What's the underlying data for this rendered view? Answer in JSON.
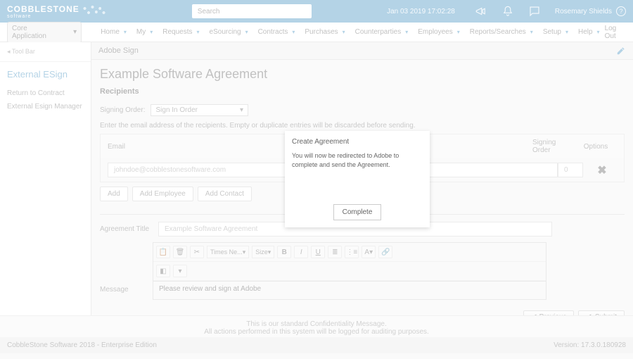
{
  "brand": {
    "name": "COBBLESTONE",
    "sub": "software"
  },
  "search": {
    "placeholder": "Search"
  },
  "timestamp": "Jan 03 2019 17:02:28",
  "user": {
    "name": "Rosemary Shields"
  },
  "app_selector": "Core Application",
  "menu": [
    "Home",
    "My",
    "Requests",
    "eSourcing",
    "Contracts",
    "Purchases",
    "Counterparties",
    "Employees",
    "Reports/Searches",
    "Setup",
    "Help"
  ],
  "logout": "Log Out",
  "sidebar": {
    "toolbar": "◂ Tool Bar",
    "title": "External ESign",
    "links": [
      "Return to Contract",
      "External Esign Manager"
    ]
  },
  "pane": {
    "header": "Adobe Sign"
  },
  "page": {
    "title": "Example Software Agreement",
    "section": "Recipients",
    "signing_label": "Signing Order:",
    "signing_value": "Sign In Order",
    "hint": "Enter the email address of the recipients. Empty or duplicate entries will be discarded before sending.",
    "col_email": "Email",
    "col_order": "Signing Order",
    "col_options": "Options",
    "email_value": "johndoe@cobblestonesoftware.com",
    "order_value": "0",
    "add": "Add",
    "add_employee": "Add Employee",
    "add_contact": "Add Contact",
    "agreement_title_label": "Agreement Title",
    "agreement_title_value": "Example Software Agreement",
    "message_label": "Message",
    "message_value": "Please review and sign at Adobe",
    "editor": {
      "font": "Times Ne...",
      "size": "Size"
    },
    "previous": "Previous",
    "submit": "Submit"
  },
  "modal": {
    "title": "Create Agreement",
    "body": "You will now be redirected to Adobe to complete and send the Agreement.",
    "button": "Complete"
  },
  "footer": {
    "line1": "This is our standard Confidentiality Message.",
    "line2": "All actions performed in this system will be logged for auditing purposes.",
    "left": "CobbleStone Software 2018 - Enterprise Edition",
    "right": "Version: 17.3.0.180928"
  }
}
